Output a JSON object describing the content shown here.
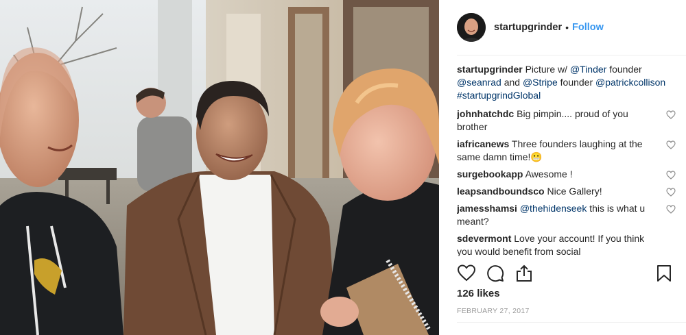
{
  "colors": {
    "link_blue": "#3897f0",
    "mention_blue": "#003569",
    "text": "#262626",
    "muted": "#999999",
    "divider": "#efefef"
  },
  "post": {
    "image_description_icon": "photo",
    "header": {
      "avatar_icon": "profile-avatar",
      "username": "startupgrinder",
      "separator": "•",
      "follow_label": "Follow"
    },
    "caption": {
      "username": "startupgrinder",
      "parts": [
        {
          "type": "text",
          "value": "Picture w/ "
        },
        {
          "type": "mention",
          "value": "@Tinder"
        },
        {
          "type": "text",
          "value": " founder "
        },
        {
          "type": "mention",
          "value": "@seanrad"
        },
        {
          "type": "text",
          "value": " and "
        },
        {
          "type": "mention",
          "value": "@Stripe"
        },
        {
          "type": "text",
          "value": " founder "
        },
        {
          "type": "mention",
          "value": "@patrickcollison"
        },
        {
          "type": "text",
          "value": " "
        },
        {
          "type": "mention",
          "value": "#startupgrindGlobal"
        }
      ]
    },
    "comments": [
      {
        "username": "johnhatchdc",
        "parts": [
          {
            "type": "text",
            "value": "Big pimpin.... proud of you brother"
          }
        ]
      },
      {
        "username": "iafricanews",
        "parts": [
          {
            "type": "text",
            "value": "Three founders laughing at the same damn time!😬"
          }
        ]
      },
      {
        "username": "surgebookapp",
        "parts": [
          {
            "type": "text",
            "value": "Awesome !"
          }
        ]
      },
      {
        "username": "leapsandboundsco",
        "parts": [
          {
            "type": "text",
            "value": "Nice Gallery!"
          }
        ]
      },
      {
        "username": "jamesshamsi",
        "parts": [
          {
            "type": "mention",
            "value": "@thehidenseek"
          },
          {
            "type": "text",
            "value": " this is what u meant?"
          }
        ]
      },
      {
        "username": "sdevermont",
        "parts": [
          {
            "type": "text",
            "value": "Love your account! If you think you would benefit from social"
          }
        ]
      }
    ],
    "actions": {
      "like_icon": "heart-icon",
      "comment_icon": "comment-icon",
      "share_icon": "share-icon",
      "save_icon": "bookmark-icon"
    },
    "likes": "126 likes",
    "date": "FEBRUARY 27, 2017"
  }
}
